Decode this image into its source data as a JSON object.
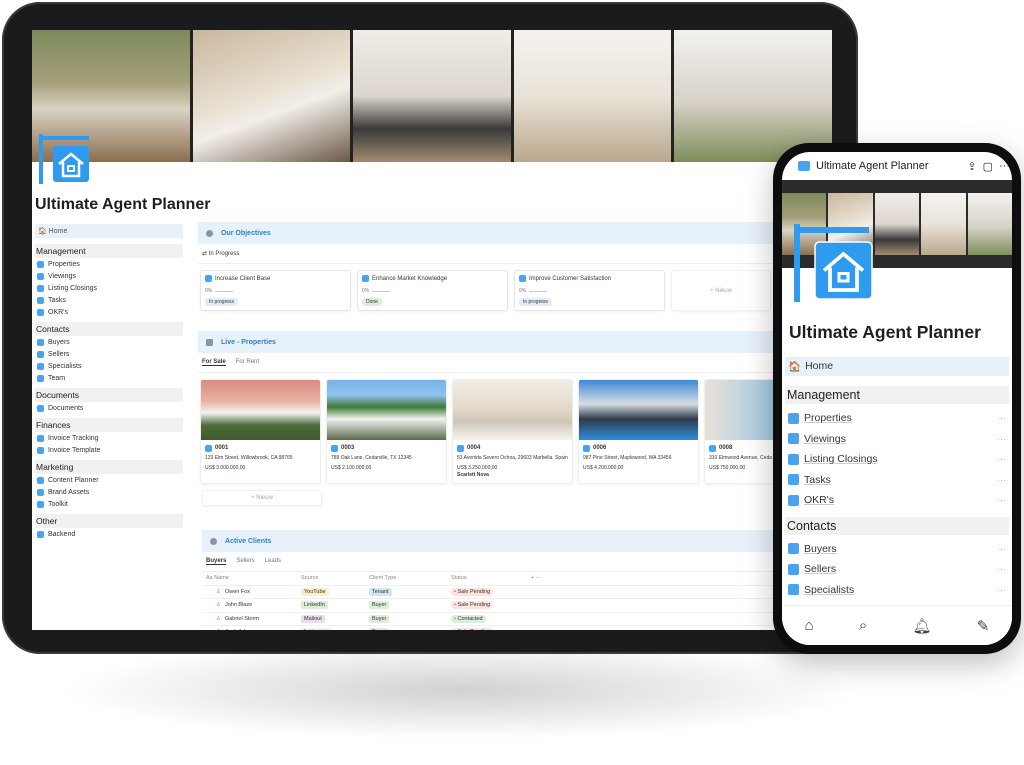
{
  "tablet": {
    "title": "Ultimate Agent Planner",
    "sidebar": {
      "home": "Home",
      "groups": [
        {
          "label": "Management",
          "items": [
            "Properties",
            "Viewings",
            "Listing Closings",
            "Tasks",
            "OKR's"
          ]
        },
        {
          "label": "Contacts",
          "items": [
            "Buyers",
            "Sellers",
            "Specialists",
            "Team"
          ]
        },
        {
          "label": "Documents",
          "items": [
            "Documents"
          ]
        },
        {
          "label": "Finances",
          "items": [
            "Invoice Tracking",
            "Invoice Template"
          ]
        },
        {
          "label": "Marketing",
          "items": [
            "Content Planner",
            "Brand Assets",
            "Toolkit"
          ]
        },
        {
          "label": "Other",
          "items": [
            "Backend"
          ]
        }
      ]
    },
    "objectives": {
      "title": "Our Objectives",
      "view": "In Progress",
      "new": "+ Nieuw",
      "cards": [
        {
          "title": "Increase Client Base",
          "progress": "0%",
          "status": "In progress"
        },
        {
          "title": "Enhance Market Knowledge",
          "progress": "0%",
          "status": "Done"
        },
        {
          "title": "Improve Customer Satisfaction",
          "progress": "0%",
          "status": "In progress"
        }
      ]
    },
    "properties": {
      "title": "Live - Properties",
      "tabs": [
        "For Sale",
        "For Rent"
      ],
      "new": "+ Nieuw",
      "cards": [
        {
          "id": "0001",
          "address": "133 Elm Street, Willowbrook, CA 98765",
          "price": "US$ 3.000.000,00"
        },
        {
          "id": "0003",
          "address": "789 Oak Lane, Cedarville, TX 12345",
          "price": "US$ 2.100.000,00"
        },
        {
          "id": "0004",
          "address": "53 Avenida Severo Ochoa, 29603 Marbella, Spain",
          "price": "US$ 3.250.000,00",
          "agent": "Scarlett Nova"
        },
        {
          "id": "0006",
          "address": "987 Pine Street, Maplewood, WA 33456",
          "price": "US$ 4.200.000,00"
        },
        {
          "id": "0008",
          "address": "310 Elmwood Avenue, Ceda",
          "price": "US$ 750.000,00"
        }
      ]
    },
    "clients": {
      "title": "Active Clients",
      "tabs": [
        "Buyers",
        "Sellers",
        "Leads"
      ],
      "columns": [
        "Aa Name",
        "Source",
        "Client Type",
        "Status",
        "+  ···"
      ],
      "rows": [
        {
          "name": "Owen Fox",
          "source": "YouTube",
          "type": "Tenant",
          "status": "Sale Pending"
        },
        {
          "name": "John Blaze",
          "source": "LinkedIn",
          "type": "Buyer",
          "status": "Sale Pending"
        },
        {
          "name": "Gabriel Storm",
          "source": "Mailout",
          "type": "Buyer",
          "status": "Contacted"
        },
        {
          "name": "Josh Johnson",
          "source": "Instagram",
          "type": "Buyer",
          "status": "Sale Pending"
        }
      ]
    }
  },
  "phone": {
    "header": "Ultimate Agent Planner",
    "title": "Ultimate Agent Planner",
    "home": "Home",
    "groups": [
      {
        "label": "Management",
        "items": [
          "Properties",
          "Viewings",
          "Listing Closings",
          "Tasks",
          "OKR's"
        ]
      },
      {
        "label": "Contacts",
        "items": [
          "Buyers",
          "Sellers",
          "Specialists"
        ]
      }
    ],
    "more": "···",
    "bottom_nav": [
      "home-icon",
      "search-icon",
      "bell-icon",
      "compose-icon"
    ]
  },
  "colors": {
    "accent": "#2f9bf0",
    "band": "#e7f1fa",
    "pending": "#fbe4e4",
    "done": "#dbeddb",
    "progress": "#e1ecf7"
  }
}
